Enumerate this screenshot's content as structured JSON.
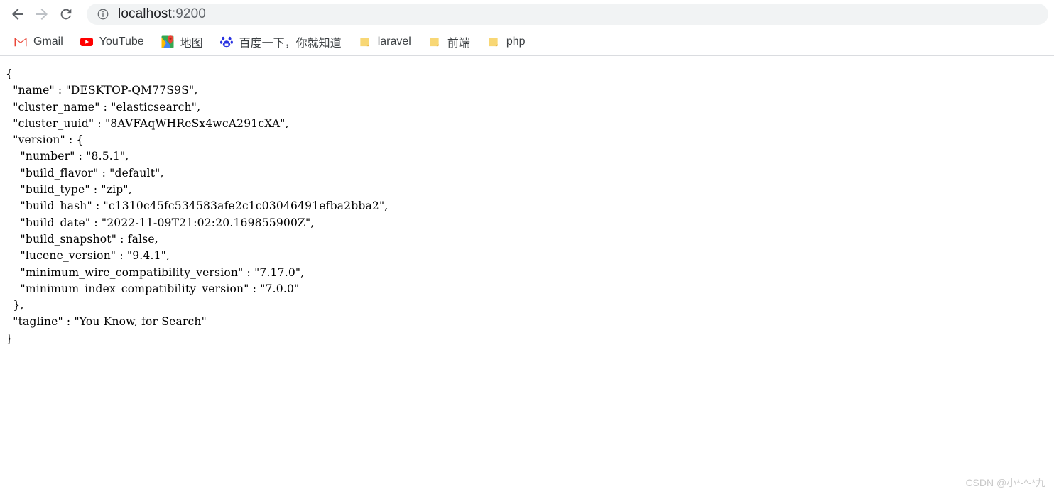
{
  "browser": {
    "back_label": "Back",
    "forward_label": "Forward",
    "reload_label": "Reload",
    "url_host": "localhost",
    "url_port": ":9200",
    "url_full": "localhost:9200",
    "site_info_tooltip": "View site information"
  },
  "bookmarks": [
    {
      "label": "Gmail",
      "icon": "gmail-icon"
    },
    {
      "label": "YouTube",
      "icon": "youtube-icon"
    },
    {
      "label": "地图",
      "icon": "google-maps-icon"
    },
    {
      "label": "百度一下，你就知道",
      "icon": "baidu-icon"
    },
    {
      "label": "laravel",
      "icon": "folder-icon"
    },
    {
      "label": "前端",
      "icon": "folder-icon"
    },
    {
      "label": "php",
      "icon": "folder-icon"
    }
  ],
  "content": {
    "json_text": "{\n  \"name\" : \"DESKTOP-QM77S9S\",\n  \"cluster_name\" : \"elasticsearch\",\n  \"cluster_uuid\" : \"8AVFAqWHReSx4wcA291cXA\",\n  \"version\" : {\n    \"number\" : \"8.5.1\",\n    \"build_flavor\" : \"default\",\n    \"build_type\" : \"zip\",\n    \"build_hash\" : \"c1310c45fc534583afe2c1c03046491efba2bba2\",\n    \"build_date\" : \"2022-11-09T21:02:20.169855900Z\",\n    \"build_snapshot\" : false,\n    \"lucene_version\" : \"9.4.1\",\n    \"minimum_wire_compatibility_version\" : \"7.17.0\",\n    \"minimum_index_compatibility_version\" : \"7.0.0\"\n  },\n  \"tagline\" : \"You Know, for Search\"\n}",
    "fields": {
      "name": "DESKTOP-QM77S9S",
      "cluster_name": "elasticsearch",
      "cluster_uuid": "8AVFAqWHReSx4wcA291cXA",
      "version_number": "8.5.1",
      "build_flavor": "default",
      "build_type": "zip",
      "build_hash": "c1310c45fc534583afe2c1c03046491efba2bba2",
      "build_date": "2022-11-09T21:02:20.169855900Z",
      "build_snapshot": "false",
      "lucene_version": "9.4.1",
      "minimum_wire_compatibility_version": "7.17.0",
      "minimum_index_compatibility_version": "7.0.0",
      "tagline": "You Know, for Search"
    }
  },
  "watermark": {
    "text": "CSDN @小*-^-*九"
  },
  "colors": {
    "omnibox_bg": "#f1f3f4",
    "url_text": "#202124",
    "url_port": "#5f6368",
    "bookmark_text": "#3c4043",
    "folder_icon": "#f8d775",
    "gmail_red": "#ea4335",
    "youtube_red": "#ff0000",
    "baidu_blue": "#2932e1",
    "watermark": "#c9c9c9"
  }
}
